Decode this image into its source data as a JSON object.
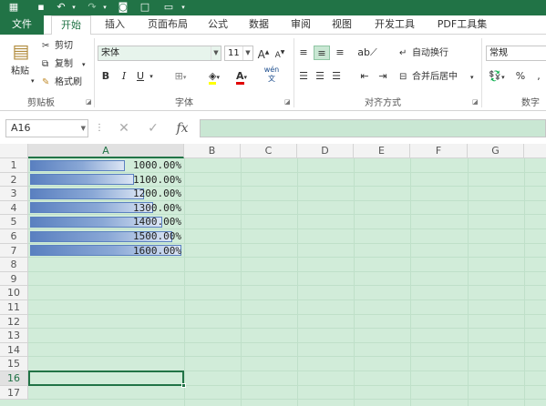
{
  "qat": {
    "save_icon": "save-icon",
    "undo_icon": "undo-icon",
    "redo_icon": "redo-icon",
    "camera_icon": "camera-icon",
    "new_icon": "new-file-icon",
    "open_icon": "open-folder-icon"
  },
  "tabs": [
    "文件",
    "开始",
    "插入",
    "页面布局",
    "公式",
    "数据",
    "审阅",
    "视图",
    "开发工具",
    "PDF工具集"
  ],
  "clipboard": {
    "paste": "粘贴",
    "cut": "剪切",
    "copy": "复制",
    "format_painter": "格式刷",
    "group": "剪贴板"
  },
  "font": {
    "name": "宋体",
    "size": "11",
    "bold": "B",
    "italic": "I",
    "underline": "U",
    "group": "字体",
    "grow": "A",
    "shrink": "A",
    "font_color": "A",
    "phonetic": "wén"
  },
  "alignment": {
    "wrap": "自动换行",
    "merge": "合并后居中",
    "group": "对齐方式"
  },
  "number": {
    "format": "常规",
    "percent": "%",
    "group": "数字"
  },
  "formula_bar": {
    "name_box": "A16",
    "cancel": "✕",
    "enter": "✓",
    "fx": "fx",
    "content": ""
  },
  "columns": [
    "A",
    "B",
    "C",
    "D",
    "E",
    "F",
    "G"
  ],
  "rows": [
    "1",
    "2",
    "3",
    "4",
    "5",
    "6",
    "7",
    "8",
    "9",
    "10",
    "11",
    "12",
    "13",
    "14",
    "15",
    "16",
    "17"
  ],
  "cells": [
    {
      "row": "1",
      "value": "1000.00%",
      "fill": 0.625
    },
    {
      "row": "2",
      "value": "1100.00%",
      "fill": 0.6875
    },
    {
      "row": "3",
      "value": "1200.00%",
      "fill": 0.75
    },
    {
      "row": "4",
      "value": "1300.00%",
      "fill": 0.8125
    },
    {
      "row": "5",
      "value": "1400.00%",
      "fill": 0.875
    },
    {
      "row": "6",
      "value": "1500.00%",
      "fill": 0.9375
    },
    {
      "row": "7",
      "value": "1600.00%",
      "fill": 1.0
    }
  ],
  "colors": {
    "accent": "#217346",
    "sheet_bg": "#d1ecd9",
    "bar": "#5a80c0"
  }
}
